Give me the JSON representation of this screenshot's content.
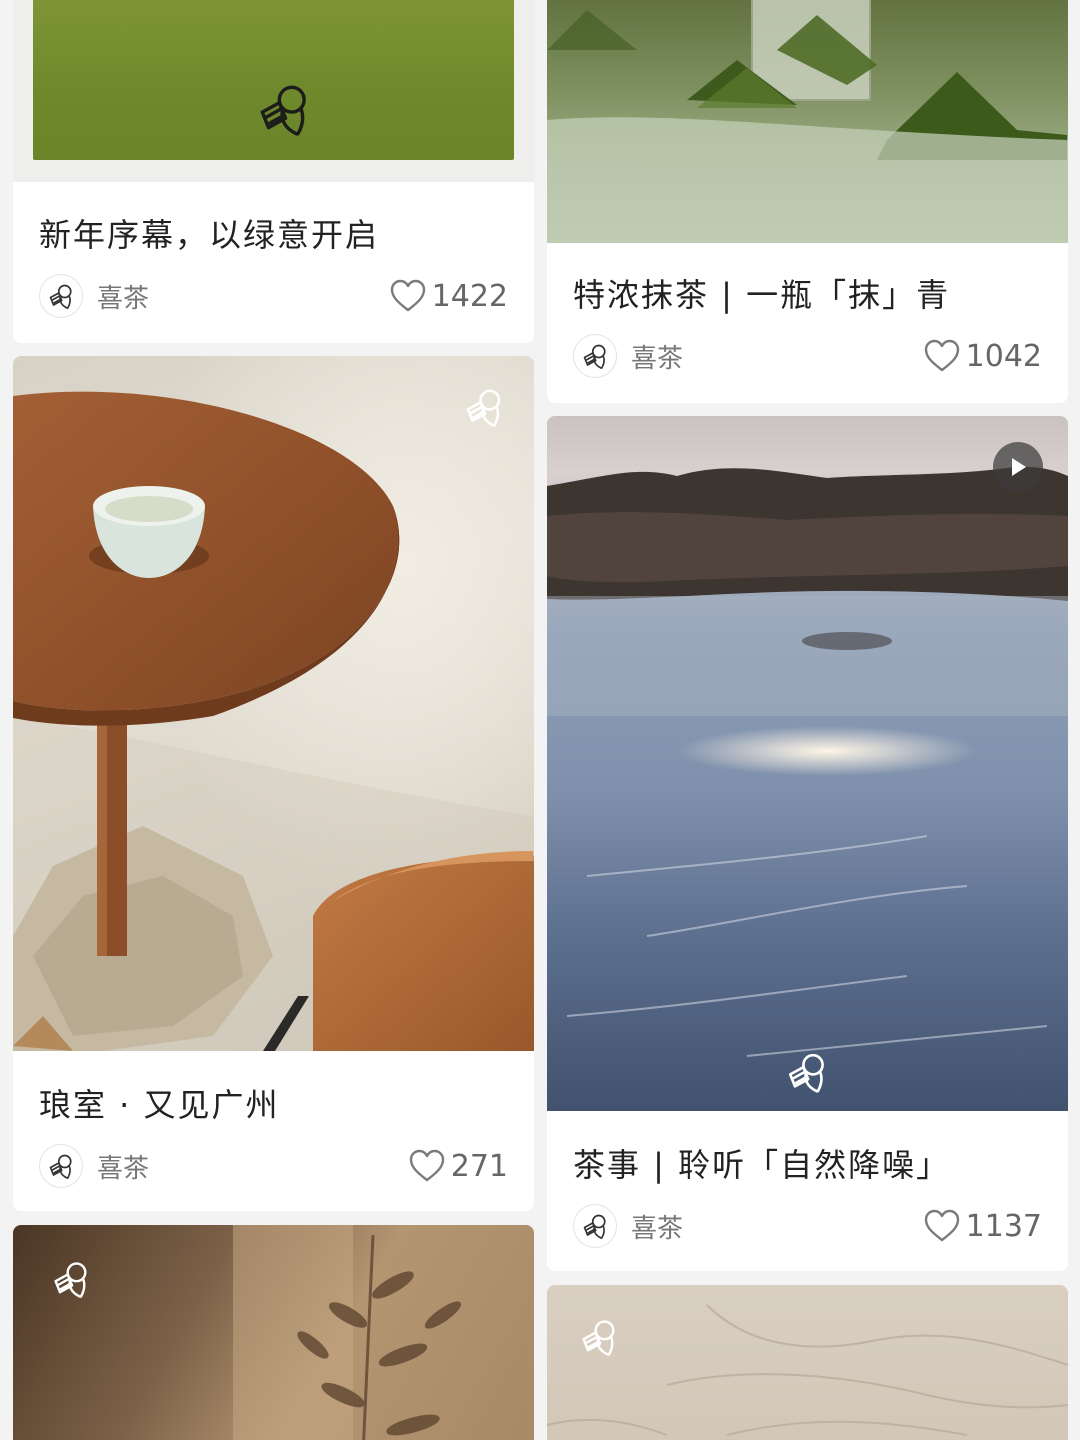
{
  "feed": {
    "left": [
      {
        "title": "新年序幕，以绿意开启",
        "author": "喜茶",
        "likes": "1422"
      },
      {
        "title": "琅室 · 又见广州",
        "author": "喜茶",
        "likes": "271"
      }
    ],
    "right": [
      {
        "title": "特浓抹茶 | 一瓶「抹」青",
        "author": "喜茶",
        "likes": "1042"
      },
      {
        "title": "茶事 | 聆听「自然降噪」",
        "author": "喜茶",
        "likes": "1137"
      }
    ]
  },
  "colors": {
    "page_bg": "#f3f3f3",
    "card_bg": "#ffffff",
    "matcha_green": "#6f8a2c"
  },
  "icons": {
    "avatar": "heytea-logo-icon",
    "like": "heart-outline-icon",
    "video": "play-icon",
    "watermark": "heytea-watermark-icon"
  }
}
